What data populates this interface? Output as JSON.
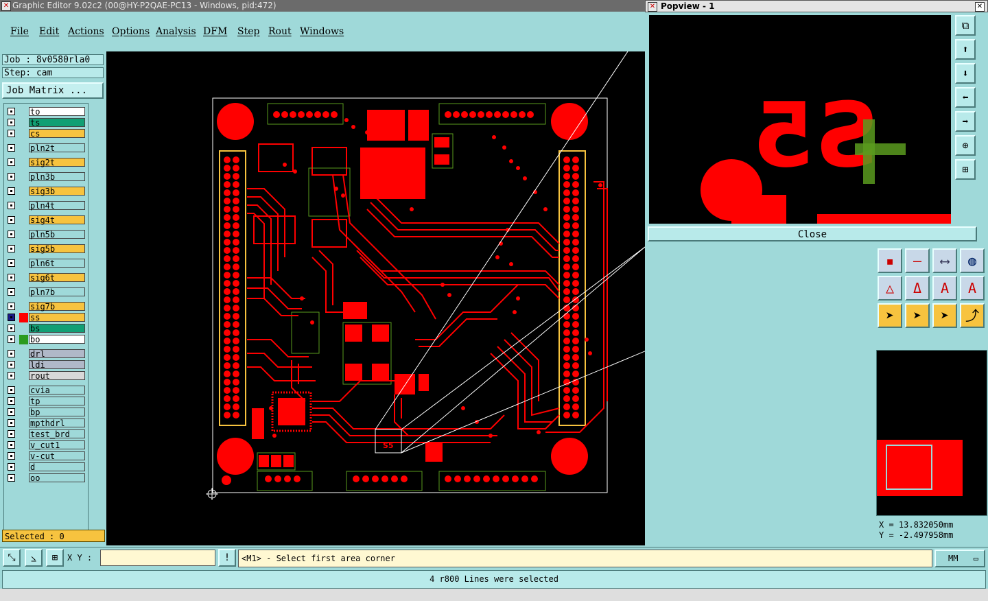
{
  "window": {
    "title": "Graphic Editor 9.02c2 (00@HY-P2QAE-PC13 - Windows, pid:472)"
  },
  "menu": [
    "File",
    "Edit",
    "Actions",
    "Options",
    "Analysis",
    "DFM",
    "Step",
    "Rout",
    "Windows"
  ],
  "job": {
    "job_label": "Job : 8v0580rla0",
    "step_label": "Step: cam",
    "matrix_button": "Job Matrix ..."
  },
  "layers": [
    {
      "name": "to",
      "color": "#ffffff"
    },
    {
      "name": "ts",
      "color": "#119f74"
    },
    {
      "name": "cs",
      "color": "#f7c33f"
    },
    {
      "name": "pln2t",
      "color": "#9fd9d9"
    },
    {
      "name": "sig2t",
      "color": "#f7c33f"
    },
    {
      "name": "pln3b",
      "color": "#9fd9d9"
    },
    {
      "name": "sig3b",
      "color": "#f7c33f"
    },
    {
      "name": "pln4t",
      "color": "#9fd9d9"
    },
    {
      "name": "sig4t",
      "color": "#f7c33f"
    },
    {
      "name": "pln5b",
      "color": "#9fd9d9"
    },
    {
      "name": "sig5b",
      "color": "#f7c33f"
    },
    {
      "name": "pln6t",
      "color": "#9fd9d9"
    },
    {
      "name": "sig6t",
      "color": "#f7c33f"
    },
    {
      "name": "pln7b",
      "color": "#9fd9d9"
    },
    {
      "name": "sig7b",
      "color": "#f7c33f"
    },
    {
      "name": "ss",
      "color": "#f7c33f"
    },
    {
      "name": "bs",
      "color": "#119f74"
    },
    {
      "name": "bo",
      "color": "#ffffff"
    },
    {
      "name": "drl",
      "color": "#b0b8c8"
    },
    {
      "name": "ldi",
      "color": "#b0b8c8"
    },
    {
      "name": "rout",
      "color": "#d8d8d8"
    },
    {
      "name": "cvia",
      "color": "#9fd9d9"
    },
    {
      "name": "tp",
      "color": "#9fd9d9"
    },
    {
      "name": "bp",
      "color": "#9fd9d9"
    },
    {
      "name": "mpthdrl",
      "color": "#9fd9d9"
    },
    {
      "name": "test_brd",
      "color": "#9fd9d9"
    },
    {
      "name": "v_cut1",
      "color": "#9fd9d9"
    },
    {
      "name": "v-cut",
      "color": "#9fd9d9"
    },
    {
      "name": "d",
      "color": "#9fd9d9"
    },
    {
      "name": "oo",
      "color": "#9fd9d9"
    }
  ],
  "selected": "Selected : 0",
  "popview": {
    "title": "Popview - 1",
    "close_label": "Close",
    "label": "S5"
  },
  "board": {
    "label": "S5"
  },
  "coords": {
    "x": "X  =  13.832050mm",
    "y": "Y  = -2.497958mm"
  },
  "bottom": {
    "xy_label": "X Y :",
    "prompt": "<M1> - Select first area corner",
    "units": "MM"
  },
  "status": "4 r800 Lines were selected",
  "colors": {
    "panel": "#9fd9d9",
    "copper": "#ff0000",
    "silk": "#5a9b1e",
    "canvas": "#000000"
  }
}
